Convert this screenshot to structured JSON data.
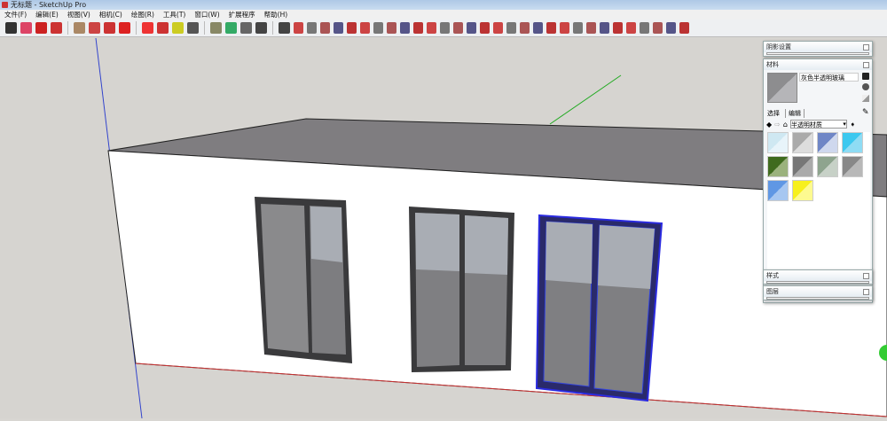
{
  "window": {
    "title": "无标题 - SketchUp Pro"
  },
  "menu": [
    "文件(F)",
    "编辑(E)",
    "视图(V)",
    "相机(C)",
    "绘图(R)",
    "工具(T)",
    "窗口(W)",
    "扩展程序",
    "帮助(H)"
  ],
  "toolbar": {
    "icons": [
      "select",
      "eraser",
      "pencil",
      "arc",
      "rectangle",
      "push-pull",
      "follow-me",
      "move",
      "rotate",
      "scale",
      "tape-measure",
      "text",
      "paint-bucket",
      "orbit",
      "pan",
      "zoom",
      "zoom-extents"
    ],
    "colors": [
      "#333",
      "#d46",
      "#c22",
      "#c33",
      "#a86",
      "#c44",
      "#c33",
      "#d22",
      "#e33",
      "#c33",
      "#cc2",
      "#555",
      "#886",
      "#3a6",
      "#666",
      "#444",
      "#444"
    ]
  },
  "panels": {
    "shadow": {
      "title": "阴影设置"
    },
    "materials": {
      "title": "材料",
      "name": "灰色半透明玻璃",
      "tabs": [
        "选择",
        "编辑"
      ],
      "collection": "半透明材质",
      "swatches": [
        [
          "#cfe8f2",
          "#e8f4fa"
        ],
        [
          "#aaa",
          "#ddd"
        ],
        [
          "#6f86c6",
          "#cfd8ee"
        ],
        [
          "#3cc8ef",
          "#8fdcf4"
        ],
        [
          "#3f6b1e",
          "#9bb27d"
        ],
        [
          "#777",
          "#aaa"
        ],
        [
          "#8ea48e",
          "#c7d1c7"
        ],
        [
          "#888",
          "#b8b8b8"
        ],
        [
          "#5f97e4",
          "#a7c7f1"
        ],
        [
          "#f7f01d",
          "#fdfa90"
        ]
      ]
    },
    "styles": {
      "title": "样式"
    },
    "layers": {
      "title": "图层"
    }
  }
}
